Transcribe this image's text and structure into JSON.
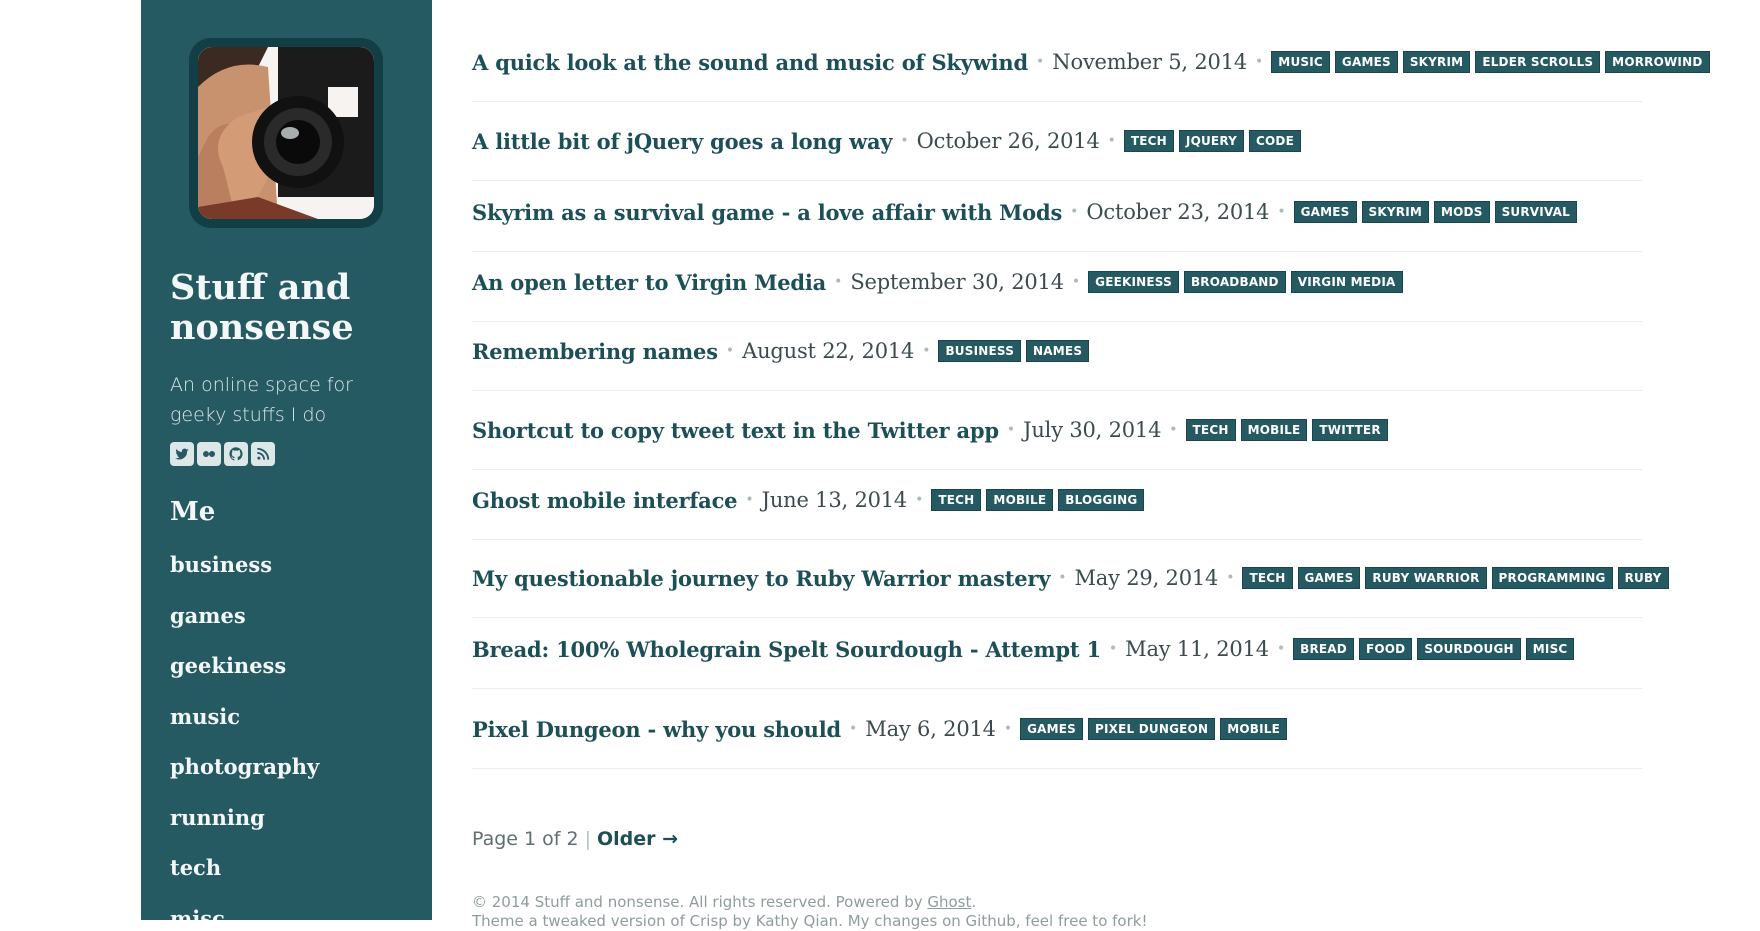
{
  "sidebar": {
    "title": "Stuff and nonsense",
    "description": "An online space for geeky stuffs I do",
    "social": [
      {
        "icon": "twitter-icon"
      },
      {
        "icon": "flickr-icon"
      },
      {
        "icon": "github-icon"
      },
      {
        "icon": "rss-icon"
      }
    ],
    "me_heading": "Me",
    "nav": [
      "business",
      "games",
      "geekiness",
      "music",
      "photography",
      "running",
      "tech",
      "misc"
    ]
  },
  "posts": [
    {
      "title": "A quick look at the sound and music of Skywind",
      "date": "November 5, 2014",
      "tags": [
        "MUSIC",
        "GAMES",
        "SKYRIM",
        "ELDER SCROLLS",
        "MORROWIND"
      ]
    },
    {
      "title": "A little bit of jQuery goes a long way",
      "date": "October 26, 2014",
      "tags": [
        "TECH",
        "JQUERY",
        "CODE"
      ]
    },
    {
      "title": "Skyrim as a survival game - a love affair with Mods",
      "date": "October 23, 2014",
      "tags": [
        "GAMES",
        "SKYRIM",
        "MODS",
        "SURVIVAL"
      ]
    },
    {
      "title": "An open letter to Virgin Media",
      "date": "September 30, 2014",
      "tags": [
        "GEEKINESS",
        "BROADBAND",
        "VIRGIN MEDIA"
      ]
    },
    {
      "title": "Remembering names",
      "date": "August 22, 2014",
      "tags": [
        "BUSINESS",
        "NAMES"
      ]
    },
    {
      "title": "Shortcut to copy tweet text in the Twitter app",
      "date": "July 30, 2014",
      "tags": [
        "TECH",
        "MOBILE",
        "TWITTER"
      ]
    },
    {
      "title": "Ghost mobile interface",
      "date": "June 13, 2014",
      "tags": [
        "TECH",
        "MOBILE",
        "BLOGGING"
      ]
    },
    {
      "title": "My questionable journey to Ruby Warrior mastery",
      "date": "May 29, 2014",
      "tags": [
        "TECH",
        "GAMES",
        "RUBY WARRIOR",
        "PROGRAMMING",
        "RUBY"
      ]
    },
    {
      "title": "Bread: 100% Wholegrain Spelt Sourdough - Attempt 1",
      "date": "May 11, 2014",
      "tags": [
        "BREAD",
        "FOOD",
        "SOURDOUGH",
        "MISC"
      ]
    },
    {
      "title": "Pixel Dungeon - why you should",
      "date": "May 6, 2014",
      "tags": [
        "GAMES",
        "PIXEL DUNGEON",
        "MOBILE"
      ]
    }
  ],
  "pagination": {
    "page_text": "Page 1 of 2",
    "separator": "|",
    "older_label": "Older →"
  },
  "footer": {
    "copyright_prefix": "© 2014 Stuff and nonsense. All rights reserved. Powered by ",
    "ghost_link": "Ghost",
    "copyright_suffix": ".",
    "theme_line": "Theme a tweaked version of Crisp by Kathy Qian. My changes on Github, feel free to fork!"
  },
  "colors": {
    "sidebar_bg": "#265a63",
    "accent": "#1d4f57",
    "tag_bg": "#265a63"
  }
}
